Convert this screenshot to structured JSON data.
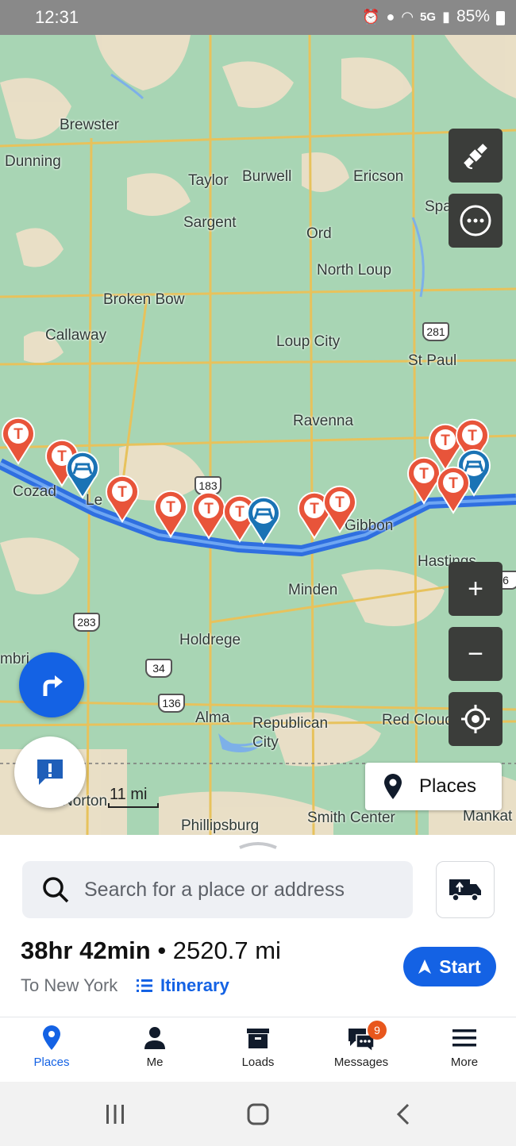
{
  "status_bar": {
    "time": "12:31",
    "network": "5G",
    "battery": "85%",
    "icons": [
      "alarm-icon",
      "location-icon",
      "wifi-icon",
      "signal-icon",
      "battery-icon"
    ]
  },
  "map": {
    "towns": [
      {
        "name": "Brewster"
      },
      {
        "name": "Dunning"
      },
      {
        "name": "Taylor"
      },
      {
        "name": "Burwell"
      },
      {
        "name": "Ericson"
      },
      {
        "name": "Spalding"
      },
      {
        "name": "Sargent"
      },
      {
        "name": "Ord"
      },
      {
        "name": "North Loup"
      },
      {
        "name": "Broken Bow"
      },
      {
        "name": "Callaway"
      },
      {
        "name": "Loup City"
      },
      {
        "name": "St Paul"
      },
      {
        "name": "Ravenna"
      },
      {
        "name": "Cozad"
      },
      {
        "name": "Le"
      },
      {
        "name": "Gibbon"
      },
      {
        "name": "Hastings"
      },
      {
        "name": "Minden"
      },
      {
        "name": "Holdrege"
      },
      {
        "name": "Alma"
      },
      {
        "name": "Republican"
      },
      {
        "name": "City"
      },
      {
        "name": "Red Cloud"
      },
      {
        "name": "Norton"
      },
      {
        "name": "Phillipsburg"
      },
      {
        "name": "Smith Center"
      },
      {
        "name": "Mankat"
      },
      {
        "name": "mbri"
      }
    ],
    "shields": [
      "281",
      "183",
      "283",
      "34",
      "136",
      "6"
    ],
    "scale_label": "11 mi",
    "places_button_label": "Places",
    "colors": {
      "route": "#2f6fe0",
      "truck_stop_pin": "#e8543a",
      "rest_area_pin": "#1a73b5",
      "map_land": "#a8d5b4"
    }
  },
  "map_controls": {
    "satellite": "satellite-icon",
    "layers": "layers-icon",
    "zoom_in": "+",
    "zoom_out": "−",
    "locate": "crosshair-icon"
  },
  "search": {
    "placeholder": "Search for a place or address"
  },
  "trip": {
    "duration": "38hr 42min",
    "separator": " • ",
    "distance": "2520.7 mi",
    "destination": "To New York",
    "itinerary_label": "Itinerary",
    "start_label": "Start"
  },
  "tabs": [
    {
      "label": "Places",
      "icon": "location-pin-icon",
      "active": true
    },
    {
      "label": "Me",
      "icon": "person-icon",
      "active": false
    },
    {
      "label": "Loads",
      "icon": "archive-box-icon",
      "active": false
    },
    {
      "label": "Messages",
      "icon": "chat-icon",
      "active": false,
      "badge": "9"
    },
    {
      "label": "More",
      "icon": "menu-icon",
      "active": false
    }
  ],
  "accent_color": "#1462e4"
}
